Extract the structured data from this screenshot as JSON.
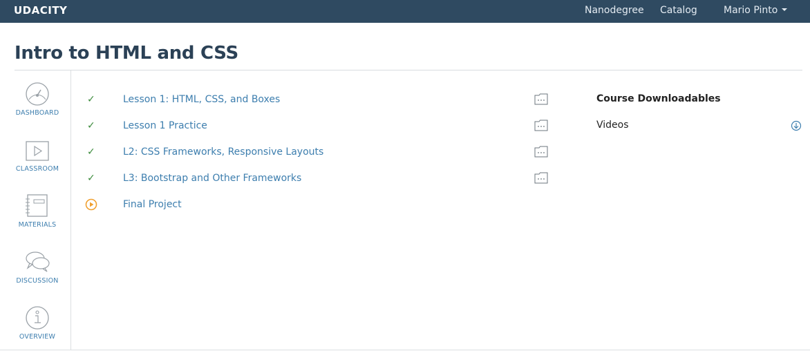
{
  "header": {
    "logo": "UDACITY",
    "nav": [
      "Nanodegree",
      "Catalog"
    ],
    "user_name": "Mario Pinto"
  },
  "page": {
    "title": "Intro to HTML and CSS"
  },
  "sidebar": {
    "items": [
      {
        "label": "DASHBOARD",
        "icon": "gauge-icon"
      },
      {
        "label": "CLASSROOM",
        "icon": "play-icon"
      },
      {
        "label": "MATERIALS",
        "icon": "notebook-icon"
      },
      {
        "label": "DISCUSSION",
        "icon": "chat-bubbles-icon"
      },
      {
        "label": "OVERVIEW",
        "icon": "info-icon"
      }
    ]
  },
  "lessons": [
    {
      "title": "Lesson 1: HTML, CSS, and Boxes",
      "status": "complete",
      "status_glyph": "✓"
    },
    {
      "title": "Lesson 1 Practice",
      "status": "complete",
      "status_glyph": "✓"
    },
    {
      "title": "L2: CSS Frameworks, Responsive Layouts",
      "status": "complete",
      "status_glyph": "✓"
    },
    {
      "title": "L3: Bootstrap and Other Frameworks",
      "status": "complete",
      "status_glyph": "✓"
    },
    {
      "title": "Final Project",
      "status": "in-progress"
    }
  ],
  "downloads": {
    "title": "Course Downloadables",
    "items": [
      {
        "label": "Videos",
        "icon": "download-icon"
      }
    ]
  },
  "colors": {
    "topbar": "#2f4a61",
    "link": "#3d7eae",
    "check": "#3a8a3a",
    "accent_orange": "#f0a030"
  }
}
